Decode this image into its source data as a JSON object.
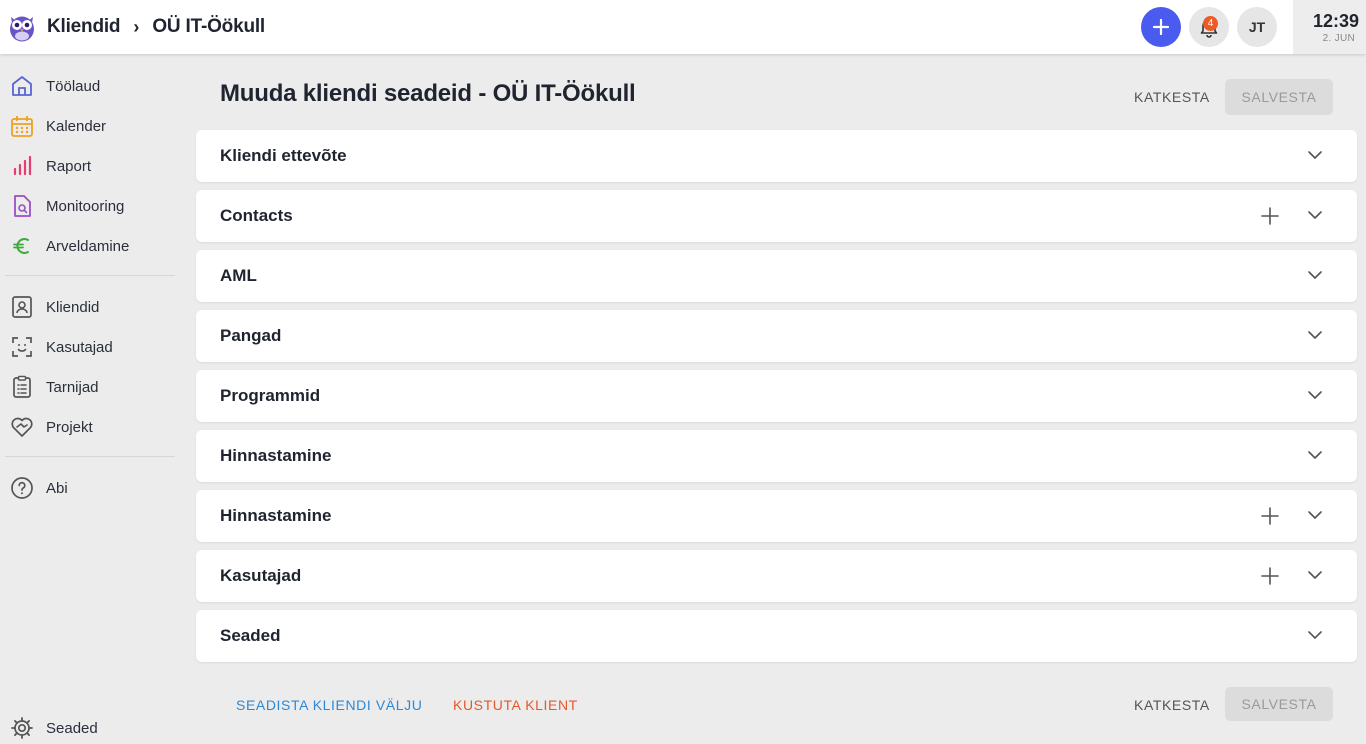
{
  "header": {
    "breadcrumb": [
      "Kliendid",
      "OÜ IT-Öökull"
    ],
    "separator": "›",
    "notifications_count": "4",
    "user_initials": "JT",
    "clock_time": "12:39",
    "clock_date": "2. JUN",
    "accent_color": "#4a5bf0"
  },
  "sidebar": {
    "items": [
      {
        "label": "Töölaud",
        "icon": "home-icon",
        "color": "#5865d6"
      },
      {
        "label": "Kalender",
        "icon": "calendar-icon",
        "color": "#f0a020"
      },
      {
        "label": "Raport",
        "icon": "bar-chart-icon",
        "color": "#e43d70"
      },
      {
        "label": "Monitooring",
        "icon": "document-search-icon",
        "color": "#9b4fc6"
      },
      {
        "label": "Arveldamine",
        "icon": "euro-icon",
        "color": "#3caa3c"
      },
      {
        "label": "Kliendid",
        "icon": "contact-card-icon",
        "color": "#555"
      },
      {
        "label": "Kasutajad",
        "icon": "face-scan-icon",
        "color": "#555"
      },
      {
        "label": "Tarnijad",
        "icon": "clipboard-list-icon",
        "color": "#555"
      },
      {
        "label": "Projekt",
        "icon": "heart-handshake-icon",
        "color": "#555"
      },
      {
        "label": "Abi",
        "icon": "help-circle-icon",
        "color": "#555"
      }
    ],
    "settings_label": "Seaded"
  },
  "main": {
    "title": "Muuda kliendi seadeid - OÜ IT-Öökull",
    "cancel_label": "KATKESTA",
    "save_label": "SALVESTA",
    "sections": [
      {
        "title": "Kliendi ettevõte",
        "has_add": false
      },
      {
        "title": "Contacts",
        "has_add": true
      },
      {
        "title": "AML",
        "has_add": false
      },
      {
        "title": "Pangad",
        "has_add": false
      },
      {
        "title": "Programmid",
        "has_add": false
      },
      {
        "title": "Hinnastamine",
        "has_add": false
      },
      {
        "title": "Hinnastamine",
        "has_add": true
      },
      {
        "title": "Kasutajad",
        "has_add": true
      },
      {
        "title": "Seaded",
        "has_add": false
      }
    ],
    "footer": {
      "configure_fields_label": "SEADISTA KLIENDI VÄLJU",
      "delete_client_label": "KUSTUTA KLIENT",
      "cancel_label": "KATKESTA",
      "save_label": "SALVESTA"
    }
  }
}
